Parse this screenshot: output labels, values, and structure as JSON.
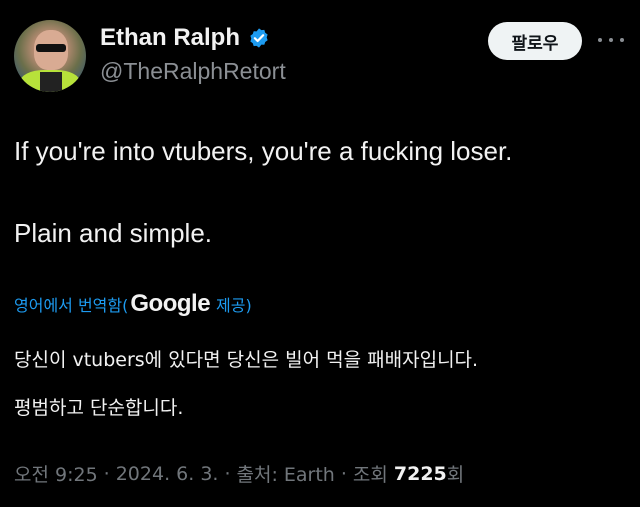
{
  "author": {
    "display_name": "Ethan Ralph",
    "handle": "@TheRalphRetort",
    "verified_icon": "verified-badge-icon",
    "verified_color": "#1d9bf0"
  },
  "actions": {
    "follow_label": "팔로우",
    "more_icon": "ellipsis-icon"
  },
  "tweet": {
    "lines": [
      "If you're into vtubers, you're a fucking loser.",
      "Plain and simple."
    ]
  },
  "translation": {
    "prefix": "영어에서 번역함(",
    "provider": "Google",
    "suffix": "제공)",
    "lines": [
      "당신이 vtubers에 있다면 당신은 빌어 먹을 패배자입니다.",
      "평범하고 단순합니다."
    ]
  },
  "meta": {
    "time": "오전 9:25",
    "sep": "·",
    "date": "2024. 6. 3.",
    "source": "출처: Earth",
    "views_label": "조회",
    "views_count": "7225",
    "views_suffix": "회"
  }
}
